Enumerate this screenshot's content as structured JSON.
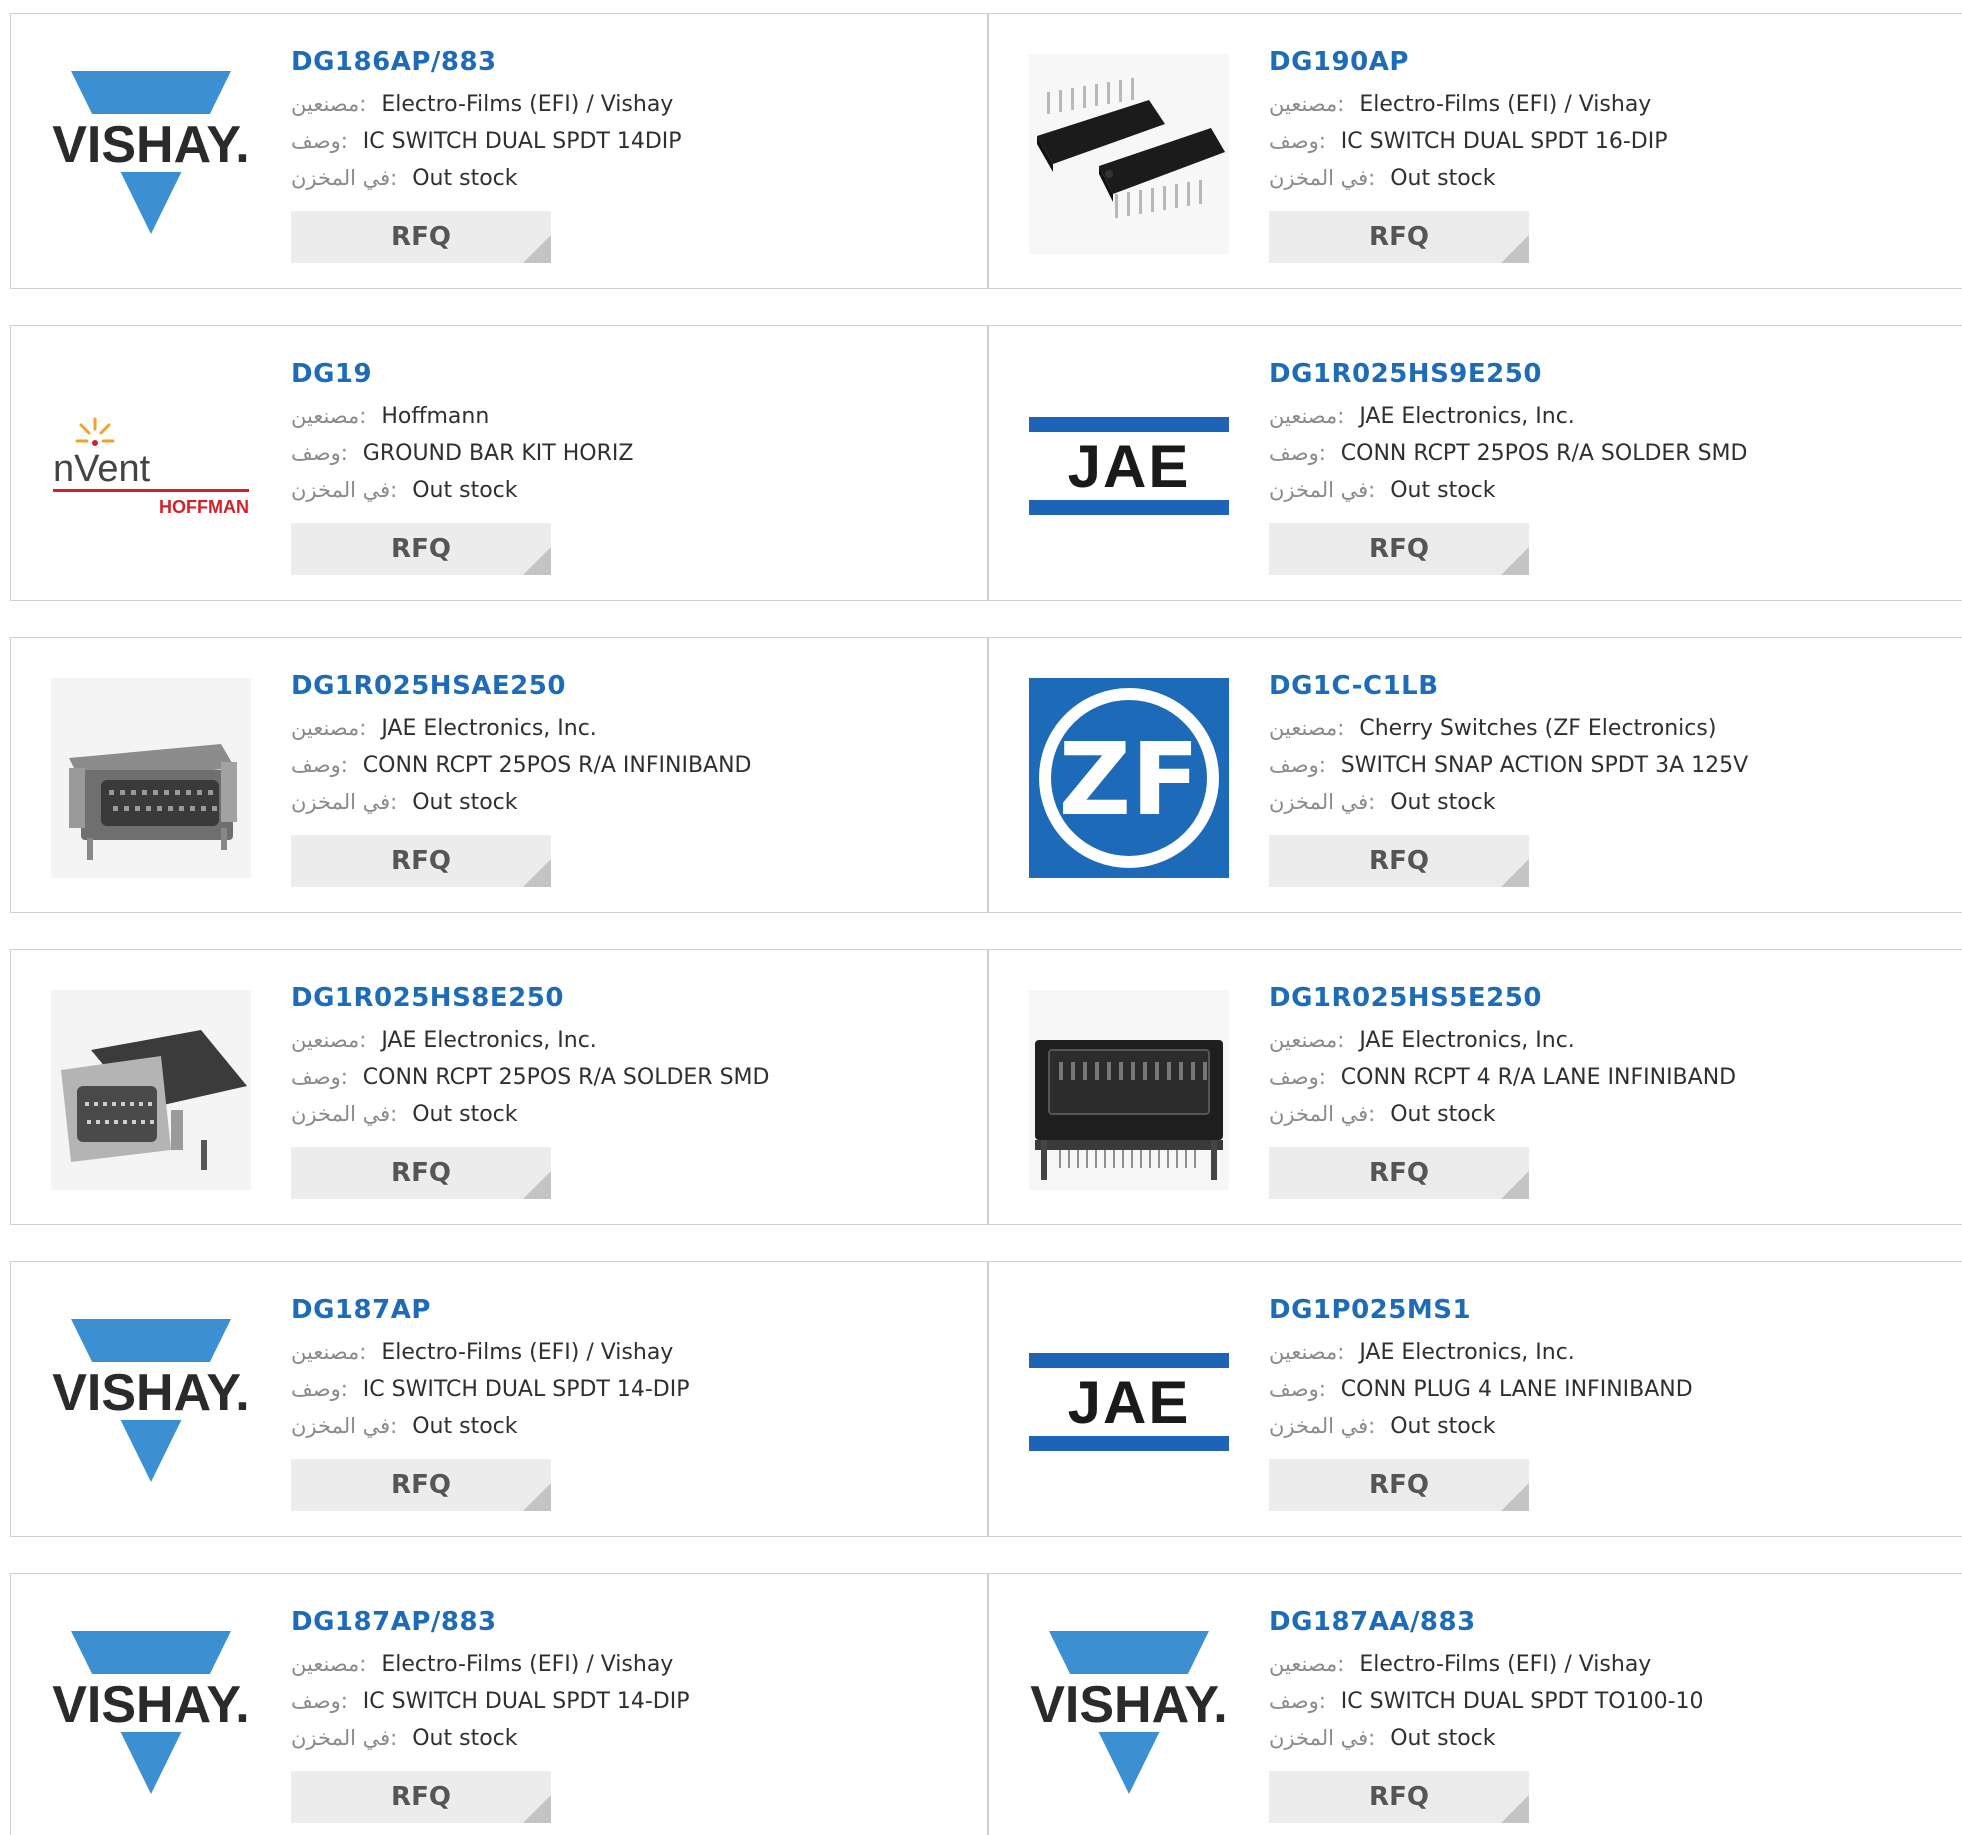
{
  "labels": {
    "manufacturer": ":مصنعين",
    "description": ":وصف",
    "stock": ":في المخزن",
    "rfq": "RFQ"
  },
  "colors": {
    "part_link": "#1e6bb8",
    "vishay_blue": "#3c8fd0",
    "jae_blue": "#1f63b6",
    "zf_blue": "#1c6ab8",
    "nvent_red": "#d4202a",
    "nvent_orange": "#f3a12b"
  },
  "products": [
    {
      "part": "DG186AP/883",
      "manufacturer": "Electro-Films (EFI) / Vishay",
      "description": "IC SWITCH DUAL SPDT 14DIP",
      "stock": "Out stock",
      "image": "vishay-logo",
      "logo_text": "VISHAY."
    },
    {
      "part": "DG190AP",
      "manufacturer": "Electro-Films (EFI) / Vishay",
      "description": "IC SWITCH DUAL SPDT 16-DIP",
      "stock": "Out stock",
      "image": "dip-chip-photo",
      "logo_text": ""
    },
    {
      "part": "DG19",
      "manufacturer": "Hoffmann",
      "description": "GROUND BAR KIT HORIZ",
      "stock": "Out stock",
      "image": "nvent-hoffman-logo",
      "logo_text": "nVent",
      "logo_subtext": "HOFFMAN"
    },
    {
      "part": "DG1R025HS9E250",
      "manufacturer": "JAE Electronics, Inc.",
      "description": "CONN RCPT 25POS R/A SOLDER SMD",
      "stock": "Out stock",
      "image": "jae-logo",
      "logo_text": "JAE"
    },
    {
      "part": "DG1R025HSAE250",
      "manufacturer": "JAE Electronics, Inc.",
      "description": "CONN RCPT 25POS R/A INFINIBAND",
      "stock": "Out stock",
      "image": "connector-photo",
      "logo_text": ""
    },
    {
      "part": "DG1C-C1LB",
      "manufacturer": "Cherry Switches (ZF Electronics)",
      "description": "SWITCH SNAP ACTION SPDT 3A 125V",
      "stock": "Out stock",
      "image": "zf-logo",
      "logo_text": "ZF"
    },
    {
      "part": "DG1R025HS8E250",
      "manufacturer": "JAE Electronics, Inc.",
      "description": "CONN RCPT 25POS R/A SOLDER SMD",
      "stock": "Out stock",
      "image": "connector-angled-photo",
      "logo_text": ""
    },
    {
      "part": "DG1R025HS5E250",
      "manufacturer": "JAE Electronics, Inc.",
      "description": "CONN RCPT 4 R/A LANE INFINIBAND",
      "stock": "Out stock",
      "image": "connector-front-photo",
      "logo_text": ""
    },
    {
      "part": "DG187AP",
      "manufacturer": "Electro-Films (EFI) / Vishay",
      "description": "IC SWITCH DUAL SPDT 14-DIP",
      "stock": "Out stock",
      "image": "vishay-logo",
      "logo_text": "VISHAY."
    },
    {
      "part": "DG1P025MS1",
      "manufacturer": "JAE Electronics, Inc.",
      "description": "CONN PLUG 4 LANE INFINIBAND",
      "stock": "Out stock",
      "image": "jae-logo",
      "logo_text": "JAE"
    },
    {
      "part": "DG187AP/883",
      "manufacturer": "Electro-Films (EFI) / Vishay",
      "description": "IC SWITCH DUAL SPDT 14-DIP",
      "stock": "Out stock",
      "image": "vishay-logo",
      "logo_text": "VISHAY."
    },
    {
      "part": "DG187AA/883",
      "manufacturer": "Electro-Films (EFI) / Vishay",
      "description": "IC SWITCH DUAL SPDT TO100-10",
      "stock": "Out stock",
      "image": "vishay-logo",
      "logo_text": "VISHAY."
    }
  ]
}
